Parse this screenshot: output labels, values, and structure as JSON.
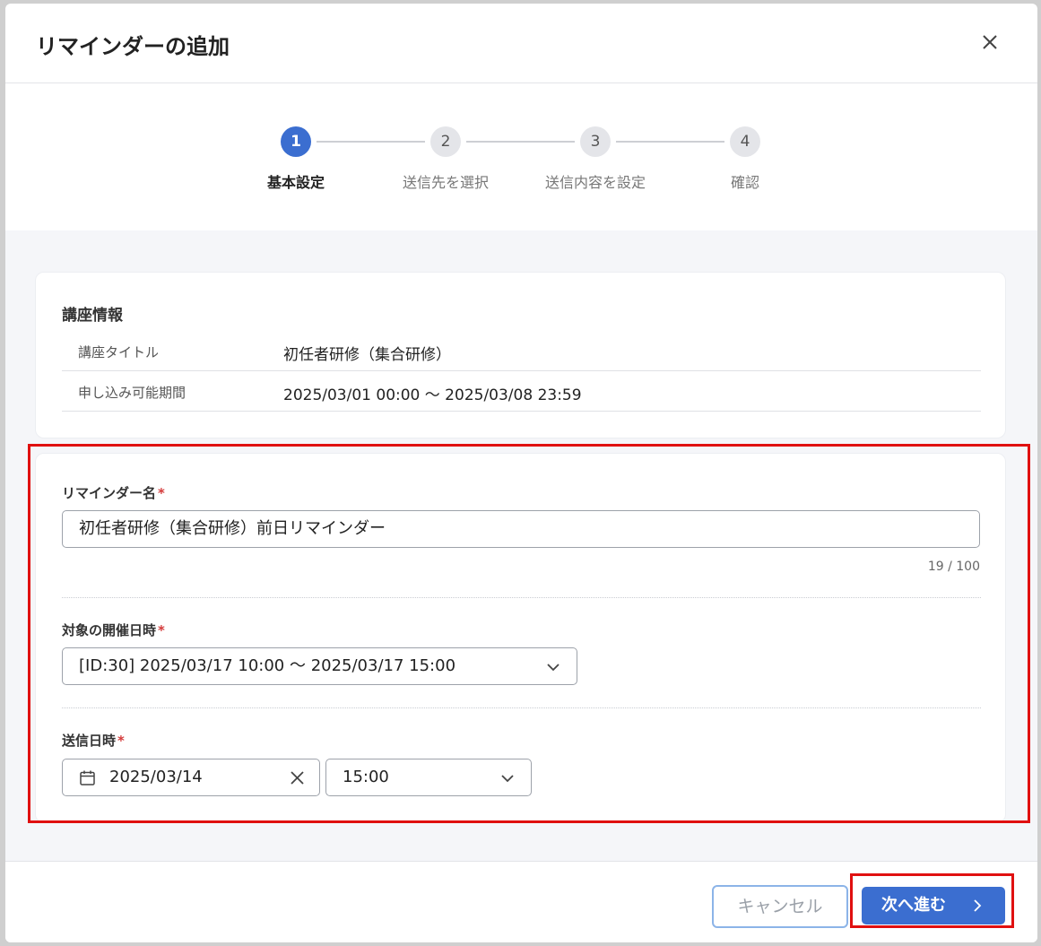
{
  "modal": {
    "title": "リマインダーの追加",
    "close_icon": "close-icon"
  },
  "stepper": {
    "steps": [
      {
        "number": "1",
        "label": "基本設定",
        "active": true
      },
      {
        "number": "2",
        "label": "送信先を選択",
        "active": false
      },
      {
        "number": "3",
        "label": "送信内容を設定",
        "active": false
      },
      {
        "number": "4",
        "label": "確認",
        "active": false
      }
    ]
  },
  "course_info": {
    "section_title": "講座情報",
    "rows": [
      {
        "key": "講座タイトル",
        "value": "初任者研修（集合研修）"
      },
      {
        "key": "申し込み可能期間",
        "value": "2025/03/01 00:00 〜 2025/03/08 23:59"
      }
    ]
  },
  "form": {
    "reminder_name": {
      "label": "リマインダー名",
      "required_mark": "*",
      "value": "初任者研修（集合研修）前日リマインダー",
      "counter": "19 / 100"
    },
    "event_datetime": {
      "label": "対象の開催日時",
      "required_mark": "*",
      "selected": "[ID:30] 2025/03/17 10:00 〜 2025/03/17 15:00"
    },
    "send_datetime": {
      "label": "送信日時",
      "required_mark": "*",
      "date": "2025/03/14",
      "time": "15:00"
    }
  },
  "footer": {
    "cancel_label": "キャンセル",
    "next_label": "次へ進む"
  },
  "colors": {
    "primary": "#3b6ed0",
    "required": "#d43a3a",
    "highlight": "#e01010"
  }
}
